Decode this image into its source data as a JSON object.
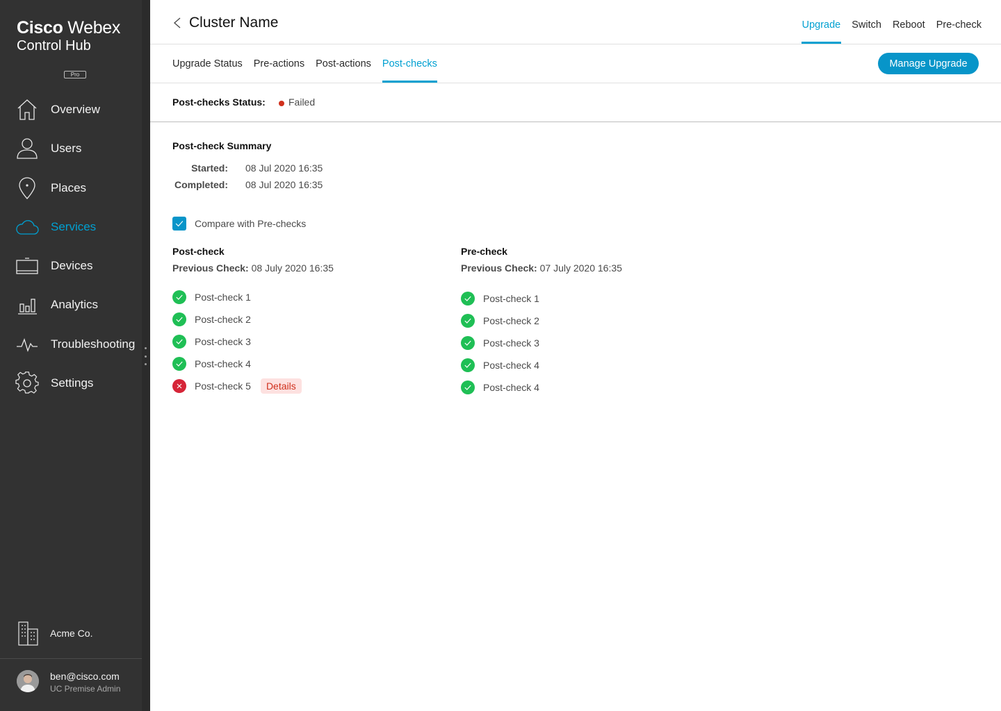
{
  "sidebar": {
    "brand": {
      "line1_bold": "Cisco",
      "line1_light": "Webex",
      "line2": "Control Hub"
    },
    "plan_badge": "Pro",
    "nav": [
      {
        "id": "overview",
        "label": "Overview",
        "icon": "home-icon",
        "active": false
      },
      {
        "id": "users",
        "label": "Users",
        "icon": "user-icon",
        "active": false
      },
      {
        "id": "places",
        "label": "Places",
        "icon": "location-pin-icon",
        "active": false
      },
      {
        "id": "services",
        "label": "Services",
        "icon": "cloud-icon",
        "active": true
      },
      {
        "id": "devices",
        "label": "Devices",
        "icon": "device-icon",
        "active": false
      },
      {
        "id": "analytics",
        "label": "Analytics",
        "icon": "bar-chart-icon",
        "active": false
      },
      {
        "id": "troubleshooting",
        "label": "Troubleshooting",
        "icon": "pulse-icon",
        "active": false
      },
      {
        "id": "settings",
        "label": "Settings",
        "icon": "gear-icon",
        "active": false
      }
    ],
    "org": {
      "label": "Acme Co.",
      "icon": "building-icon"
    },
    "user": {
      "email": "ben@cisco.com",
      "role": "UC Premise Admin"
    }
  },
  "header": {
    "title": "Cluster Name",
    "actions": [
      {
        "label": "Upgrade",
        "active": true
      },
      {
        "label": "Switch",
        "active": false
      },
      {
        "label": "Reboot",
        "active": false
      },
      {
        "label": "Pre-check",
        "active": false
      }
    ]
  },
  "tabs": [
    {
      "label": "Upgrade Status",
      "active": false
    },
    {
      "label": "Pre-actions",
      "active": false
    },
    {
      "label": "Post-actions",
      "active": false
    },
    {
      "label": "Post-checks",
      "active": true
    }
  ],
  "manage_button": "Manage Upgrade",
  "status": {
    "label": "Post-checks Status:",
    "value": "Failed",
    "color": "#d0301c"
  },
  "summary": {
    "title": "Post-check Summary",
    "started_label": "Started:",
    "started_value": "08 Jul 2020 16:35",
    "completed_label": "Completed:",
    "completed_value": "08 Jul 2020 16:35"
  },
  "compare": {
    "label": "Compare with Pre-checks",
    "checked": true
  },
  "postcheck": {
    "title": "Post-check",
    "prev_label": "Previous Check:",
    "prev_value": "08 July 2020 16:35",
    "items": [
      {
        "label": "Post-check 1",
        "status": "pass"
      },
      {
        "label": "Post-check 2",
        "status": "pass"
      },
      {
        "label": "Post-check 3",
        "status": "pass"
      },
      {
        "label": "Post-check 4",
        "status": "pass"
      },
      {
        "label": "Post-check 5",
        "status": "fail",
        "details": "Details"
      }
    ]
  },
  "precheck": {
    "title": "Pre-check",
    "prev_label": "Previous Check:",
    "prev_value": "07 July 2020 16:35",
    "items": [
      {
        "label": "Post-check 1",
        "status": "pass"
      },
      {
        "label": "Post-check 2",
        "status": "pass"
      },
      {
        "label": "Post-check 3",
        "status": "pass"
      },
      {
        "label": "Post-check 4",
        "status": "pass"
      },
      {
        "label": "Post-check 4",
        "status": "pass"
      }
    ]
  },
  "colors": {
    "accent": "#00a0d1",
    "button": "#0795c9",
    "pass": "#1fbf55",
    "fail": "#d62538",
    "sidebar_bg": "#323232"
  }
}
